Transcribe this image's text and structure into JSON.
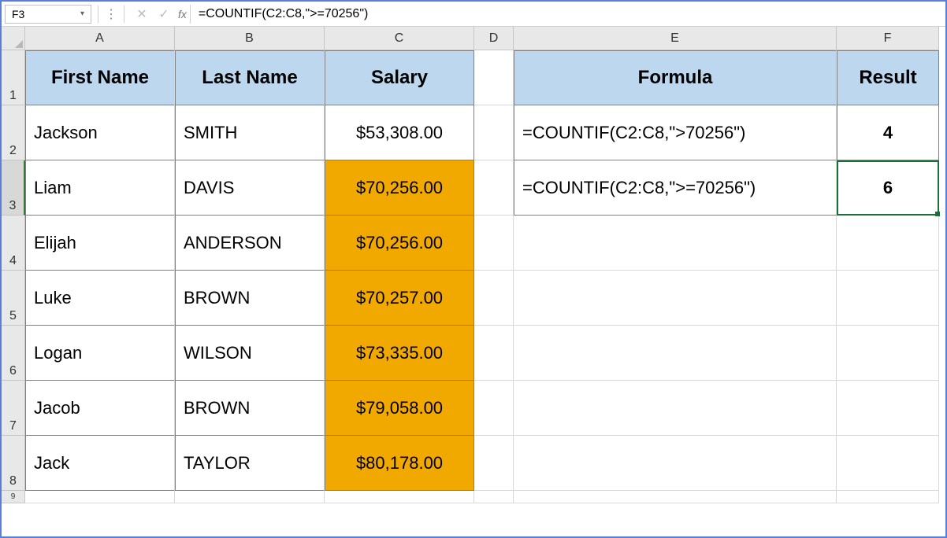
{
  "formula_bar": {
    "cell_ref": "F3",
    "formula": "=COUNTIF(C2:C8,\">=70256\")",
    "fx_label": "fx"
  },
  "columns": [
    "A",
    "B",
    "C",
    "D",
    "E",
    "F"
  ],
  "rows": [
    "1",
    "2",
    "3",
    "4",
    "5",
    "6",
    "7",
    "8",
    "9"
  ],
  "headers": {
    "first_name": "First Name",
    "last_name": "Last Name",
    "salary": "Salary",
    "formula": "Formula",
    "result": "Result"
  },
  "data": [
    {
      "first": "Jackson",
      "last": "SMITH",
      "salary": "$53,308.00",
      "hl": false
    },
    {
      "first": "Liam",
      "last": "DAVIS",
      "salary": "$70,256.00",
      "hl": true
    },
    {
      "first": "Elijah",
      "last": "ANDERSON",
      "salary": "$70,256.00",
      "hl": true
    },
    {
      "first": "Luke",
      "last": "BROWN",
      "salary": "$70,257.00",
      "hl": true
    },
    {
      "first": "Logan",
      "last": "WILSON",
      "salary": "$73,335.00",
      "hl": true
    },
    {
      "first": "Jacob",
      "last": "BROWN",
      "salary": "$79,058.00",
      "hl": true
    },
    {
      "first": "Jack",
      "last": "TAYLOR",
      "salary": "$80,178.00",
      "hl": true
    }
  ],
  "formulas": [
    {
      "text": "=COUNTIF(C2:C8,\">70256\")",
      "result": "4"
    },
    {
      "text": "=COUNTIF(C2:C8,\">=70256\")",
      "result": "6"
    }
  ],
  "active_cell": "F3"
}
